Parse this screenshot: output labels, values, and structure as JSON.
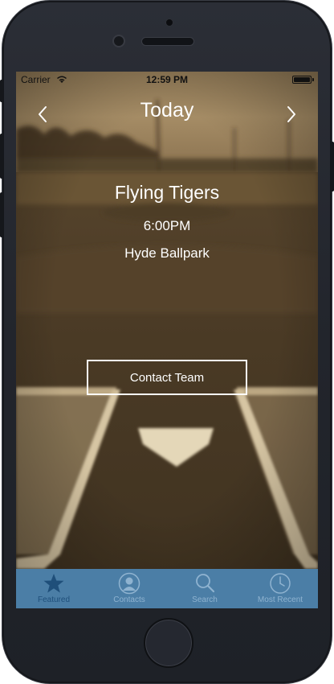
{
  "status_bar": {
    "carrier": "Carrier",
    "time": "12:59 PM"
  },
  "nav": {
    "title": "Today",
    "prev_icon": "chevron-left-icon",
    "next_icon": "chevron-right-icon"
  },
  "event": {
    "name": "Flying Tigers",
    "time": "6:00PM",
    "venue": "Hyde Ballpark"
  },
  "contact_button": {
    "label": "Contact Team"
  },
  "tab_bar": {
    "items": [
      {
        "label": "Featured",
        "icon": "star-icon",
        "selected": true
      },
      {
        "label": "Contacts",
        "icon": "person-icon",
        "selected": false
      },
      {
        "label": "Search",
        "icon": "search-icon",
        "selected": false
      },
      {
        "label": "Most Recent",
        "icon": "clock-icon",
        "selected": false
      }
    ]
  },
  "colors": {
    "tab_bar_bg": "#4b7ea6",
    "tab_selected": "#1f4f7a",
    "tab_unselected": "#8fb3d0",
    "sepia_bg": "#6e5a3e",
    "text": "#ffffff"
  }
}
